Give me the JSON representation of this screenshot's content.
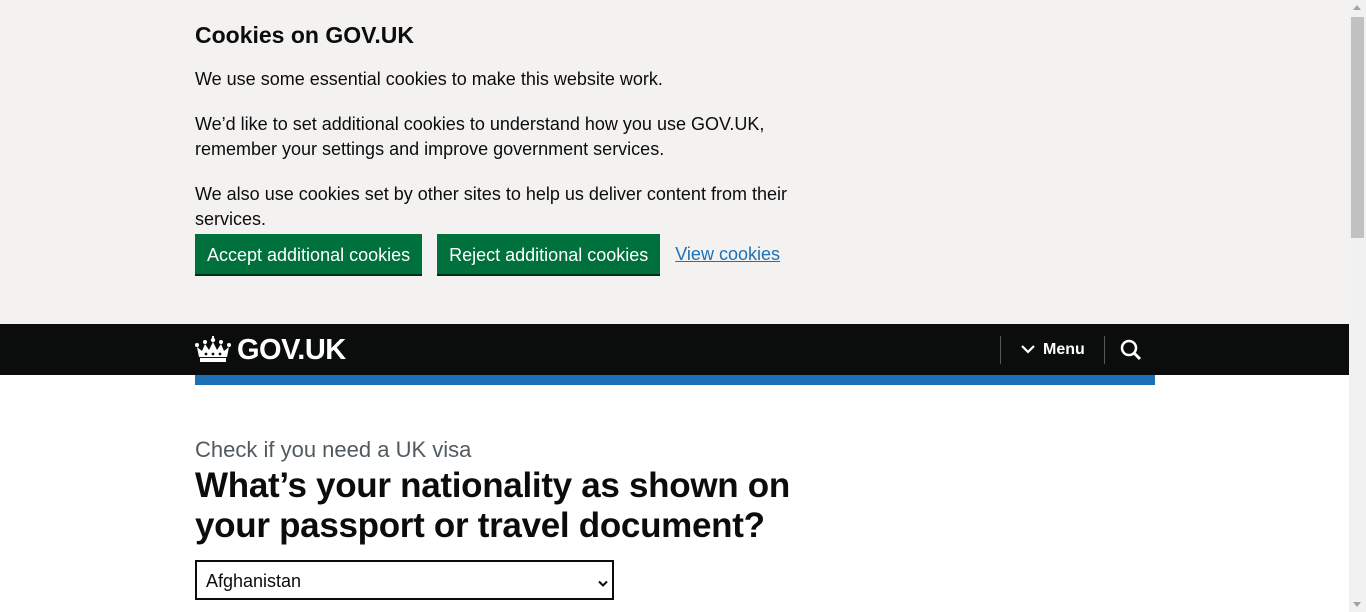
{
  "cookie_banner": {
    "title": "Cookies on GOV.UK",
    "paragraphs": [
      "We use some essential cookies to make this website work.",
      "We’d like to set additional cookies to understand how you use GOV.UK, remember your settings and improve government services.",
      "We also use cookies set by other sites to help us deliver content from their services."
    ],
    "accept_label": "Accept additional cookies",
    "reject_label": "Reject additional cookies",
    "view_label": "View cookies"
  },
  "header": {
    "logo_text": "GOV.UK",
    "menu_label": "Menu",
    "logo_icon": "crown-icon",
    "menu_icon": "chevron-down-icon",
    "search_icon": "search-icon"
  },
  "main": {
    "caption": "Check if you need a UK visa",
    "heading": "What’s your nationality as shown on your passport or travel document?",
    "nationality_select": {
      "selected": "Afghanistan"
    }
  },
  "colors": {
    "banner_bg": "#f3f2f1",
    "button_green": "#00703c",
    "link_blue": "#1d70b8",
    "header_bg": "#0b0c0c",
    "accent_bar": "#1d70b8"
  }
}
